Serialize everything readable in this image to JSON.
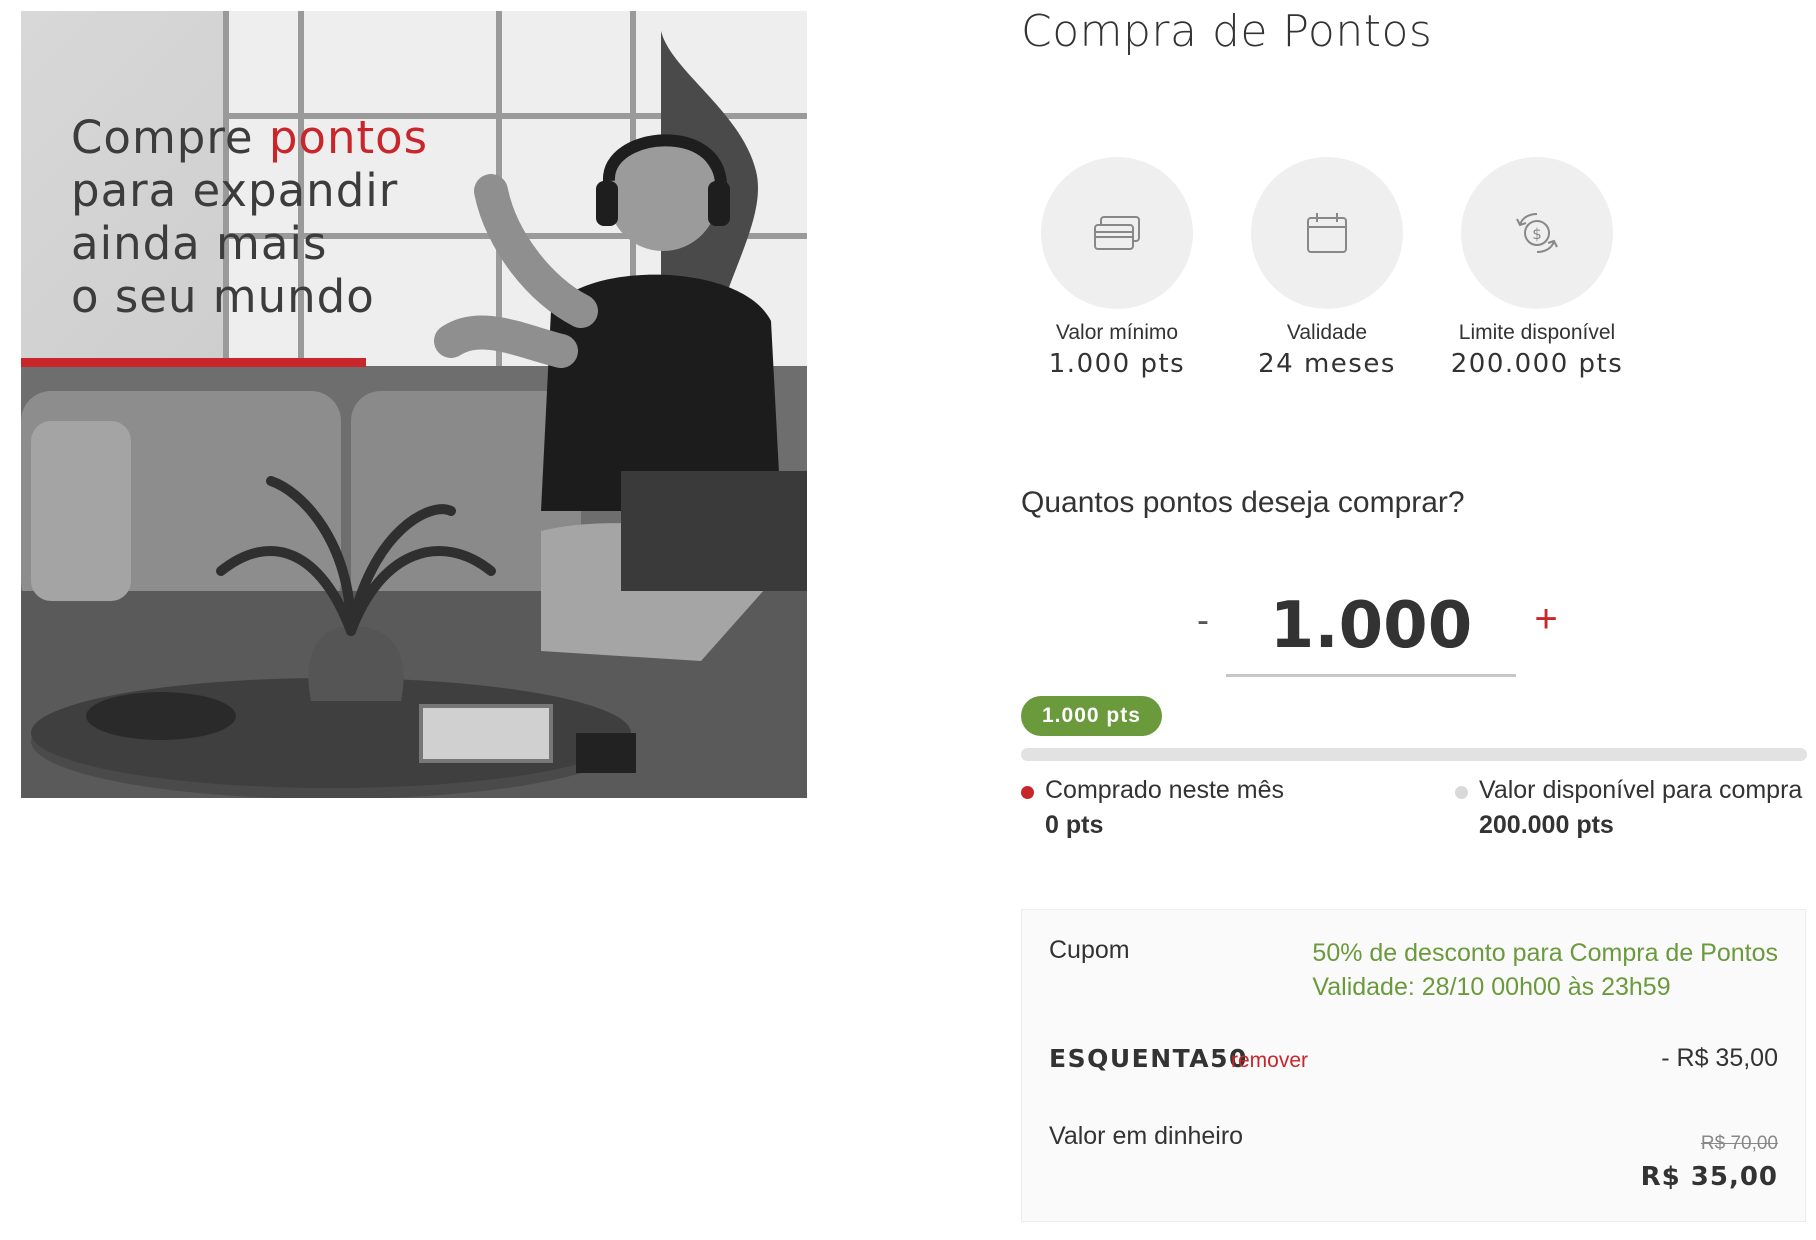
{
  "hero": {
    "text_before": "Compre ",
    "text_highlight": "pontos",
    "text_after": "para expandir\nainda mais\no seu mundo"
  },
  "page": {
    "title": "Compra de Pontos"
  },
  "info_cards": [
    {
      "icon": "credit-card-icon",
      "label": "Valor mínimo",
      "value": "1.000 pts"
    },
    {
      "icon": "calendar-icon",
      "label": "Validade",
      "value": "24 meses"
    },
    {
      "icon": "money-exchange-icon",
      "label": "Limite disponível",
      "value": "200.000 pts"
    }
  ],
  "purchase": {
    "question": "Quantos pontos deseja comprar?",
    "minus": "-",
    "plus": "+",
    "quantity": "1.000",
    "pill": "1.000 pts",
    "progress_fraction": 0
  },
  "legend": {
    "bought": {
      "label": "Comprado neste mês",
      "value": "0 pts",
      "color": "#c8262a"
    },
    "available": {
      "label": "Valor disponível para compra",
      "value": "200.000 pts",
      "color": "#d9d9d9"
    }
  },
  "summary": {
    "coupon_label": "Cupom",
    "coupon_desc_line1": "50% de desconto para Compra de Pontos",
    "coupon_desc_line2": "Validade: 28/10 00h00 às 23h59",
    "code": "ESQUENTA50",
    "remove": "remover",
    "discount": "- R$ 35,00",
    "cash_label": "Valor em dinheiro",
    "old_price": "R$ 70,00",
    "new_price": "R$ 35,00"
  },
  "colors": {
    "accent_red": "#c8262a",
    "accent_green": "#6b9a3d",
    "circle_bg": "#efefef"
  }
}
